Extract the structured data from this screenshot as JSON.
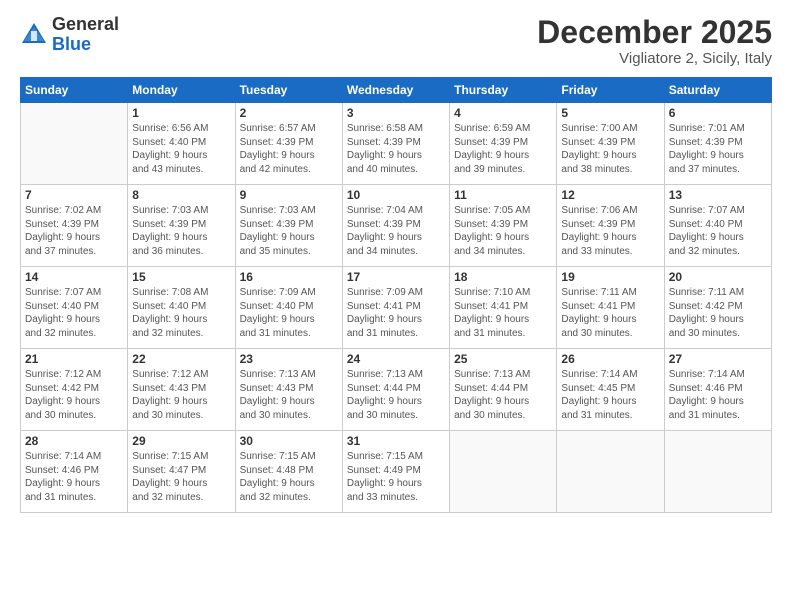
{
  "logo": {
    "general": "General",
    "blue": "Blue"
  },
  "header": {
    "month": "December 2025",
    "location": "Vigliatore 2, Sicily, Italy"
  },
  "days_of_week": [
    "Sunday",
    "Monday",
    "Tuesday",
    "Wednesday",
    "Thursday",
    "Friday",
    "Saturday"
  ],
  "weeks": [
    [
      {
        "day": "",
        "info": ""
      },
      {
        "day": "1",
        "info": "Sunrise: 6:56 AM\nSunset: 4:40 PM\nDaylight: 9 hours\nand 43 minutes."
      },
      {
        "day": "2",
        "info": "Sunrise: 6:57 AM\nSunset: 4:39 PM\nDaylight: 9 hours\nand 42 minutes."
      },
      {
        "day": "3",
        "info": "Sunrise: 6:58 AM\nSunset: 4:39 PM\nDaylight: 9 hours\nand 40 minutes."
      },
      {
        "day": "4",
        "info": "Sunrise: 6:59 AM\nSunset: 4:39 PM\nDaylight: 9 hours\nand 39 minutes."
      },
      {
        "day": "5",
        "info": "Sunrise: 7:00 AM\nSunset: 4:39 PM\nDaylight: 9 hours\nand 38 minutes."
      },
      {
        "day": "6",
        "info": "Sunrise: 7:01 AM\nSunset: 4:39 PM\nDaylight: 9 hours\nand 37 minutes."
      }
    ],
    [
      {
        "day": "7",
        "info": "Sunrise: 7:02 AM\nSunset: 4:39 PM\nDaylight: 9 hours\nand 37 minutes."
      },
      {
        "day": "8",
        "info": "Sunrise: 7:03 AM\nSunset: 4:39 PM\nDaylight: 9 hours\nand 36 minutes."
      },
      {
        "day": "9",
        "info": "Sunrise: 7:03 AM\nSunset: 4:39 PM\nDaylight: 9 hours\nand 35 minutes."
      },
      {
        "day": "10",
        "info": "Sunrise: 7:04 AM\nSunset: 4:39 PM\nDaylight: 9 hours\nand 34 minutes."
      },
      {
        "day": "11",
        "info": "Sunrise: 7:05 AM\nSunset: 4:39 PM\nDaylight: 9 hours\nand 34 minutes."
      },
      {
        "day": "12",
        "info": "Sunrise: 7:06 AM\nSunset: 4:39 PM\nDaylight: 9 hours\nand 33 minutes."
      },
      {
        "day": "13",
        "info": "Sunrise: 7:07 AM\nSunset: 4:40 PM\nDaylight: 9 hours\nand 32 minutes."
      }
    ],
    [
      {
        "day": "14",
        "info": "Sunrise: 7:07 AM\nSunset: 4:40 PM\nDaylight: 9 hours\nand 32 minutes."
      },
      {
        "day": "15",
        "info": "Sunrise: 7:08 AM\nSunset: 4:40 PM\nDaylight: 9 hours\nand 32 minutes."
      },
      {
        "day": "16",
        "info": "Sunrise: 7:09 AM\nSunset: 4:40 PM\nDaylight: 9 hours\nand 31 minutes."
      },
      {
        "day": "17",
        "info": "Sunrise: 7:09 AM\nSunset: 4:41 PM\nDaylight: 9 hours\nand 31 minutes."
      },
      {
        "day": "18",
        "info": "Sunrise: 7:10 AM\nSunset: 4:41 PM\nDaylight: 9 hours\nand 31 minutes."
      },
      {
        "day": "19",
        "info": "Sunrise: 7:11 AM\nSunset: 4:41 PM\nDaylight: 9 hours\nand 30 minutes."
      },
      {
        "day": "20",
        "info": "Sunrise: 7:11 AM\nSunset: 4:42 PM\nDaylight: 9 hours\nand 30 minutes."
      }
    ],
    [
      {
        "day": "21",
        "info": "Sunrise: 7:12 AM\nSunset: 4:42 PM\nDaylight: 9 hours\nand 30 minutes."
      },
      {
        "day": "22",
        "info": "Sunrise: 7:12 AM\nSunset: 4:43 PM\nDaylight: 9 hours\nand 30 minutes."
      },
      {
        "day": "23",
        "info": "Sunrise: 7:13 AM\nSunset: 4:43 PM\nDaylight: 9 hours\nand 30 minutes."
      },
      {
        "day": "24",
        "info": "Sunrise: 7:13 AM\nSunset: 4:44 PM\nDaylight: 9 hours\nand 30 minutes."
      },
      {
        "day": "25",
        "info": "Sunrise: 7:13 AM\nSunset: 4:44 PM\nDaylight: 9 hours\nand 30 minutes."
      },
      {
        "day": "26",
        "info": "Sunrise: 7:14 AM\nSunset: 4:45 PM\nDaylight: 9 hours\nand 31 minutes."
      },
      {
        "day": "27",
        "info": "Sunrise: 7:14 AM\nSunset: 4:46 PM\nDaylight: 9 hours\nand 31 minutes."
      }
    ],
    [
      {
        "day": "28",
        "info": "Sunrise: 7:14 AM\nSunset: 4:46 PM\nDaylight: 9 hours\nand 31 minutes."
      },
      {
        "day": "29",
        "info": "Sunrise: 7:15 AM\nSunset: 4:47 PM\nDaylight: 9 hours\nand 32 minutes."
      },
      {
        "day": "30",
        "info": "Sunrise: 7:15 AM\nSunset: 4:48 PM\nDaylight: 9 hours\nand 32 minutes."
      },
      {
        "day": "31",
        "info": "Sunrise: 7:15 AM\nSunset: 4:49 PM\nDaylight: 9 hours\nand 33 minutes."
      },
      {
        "day": "",
        "info": ""
      },
      {
        "day": "",
        "info": ""
      },
      {
        "day": "",
        "info": ""
      }
    ]
  ]
}
